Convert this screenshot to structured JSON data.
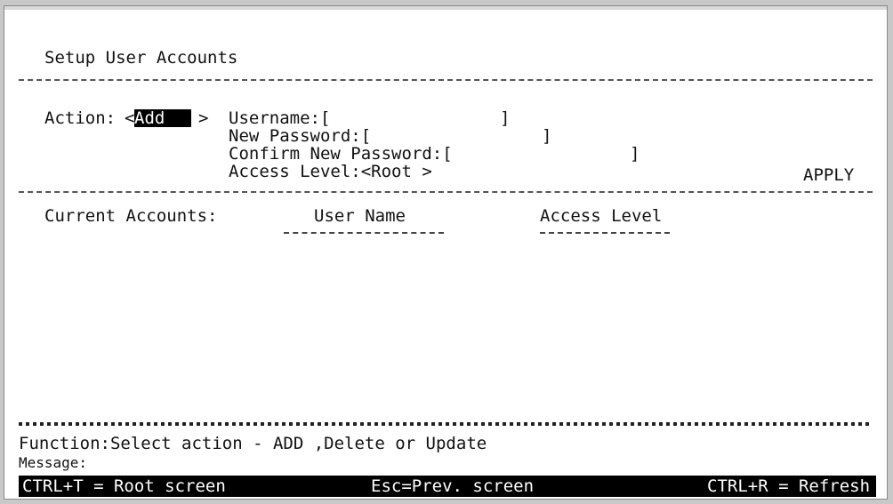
{
  "screen": {
    "title": "Setup User Accounts",
    "action_label": "Action:",
    "action_open": "<",
    "action_value": "Add",
    "action_close": ">",
    "username_label": "Username:[",
    "username_close": "]",
    "new_password_label": "New Password:[",
    "new_password_close": "]",
    "confirm_password_label": "Confirm New Password:[",
    "confirm_password_close": "]",
    "access_level_label": "Access Level:<Root >",
    "apply": "APPLY",
    "current_accounts_label": "Current Accounts:",
    "col_user_name": "User Name",
    "col_access_level": "Access Level"
  },
  "footer": {
    "function_text": "Function:Select action - ADD ,Delete or Update",
    "message_label": "Message:",
    "hotkey_root": "CTRL+T = Root screen",
    "hotkey_prev": "Esc=Prev. screen",
    "hotkey_refresh": "CTRL+R = Refresh"
  },
  "colors": {
    "background": "#ffffff",
    "text": "#111111",
    "highlight": "#000000"
  }
}
